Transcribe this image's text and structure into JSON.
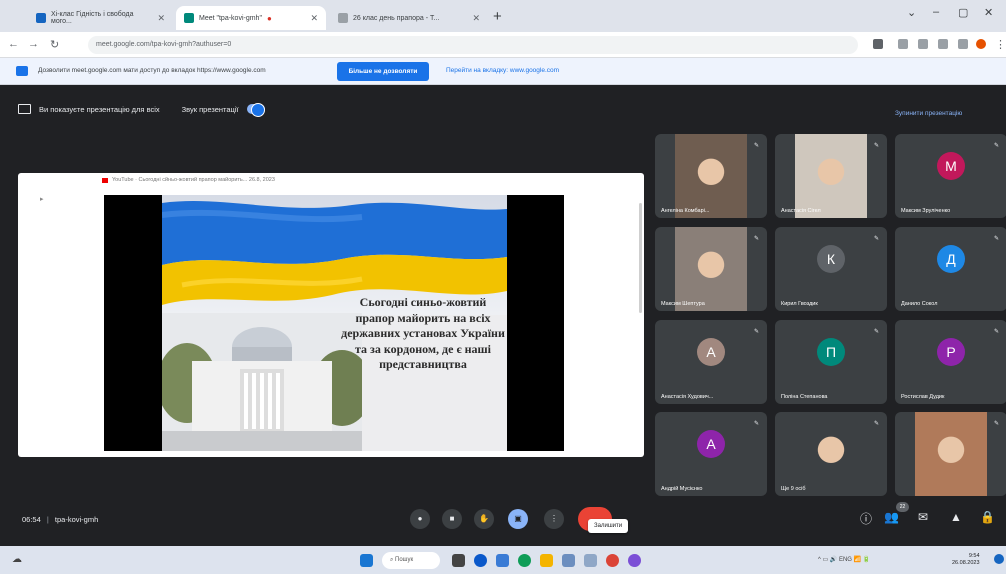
{
  "browser": {
    "tabs": [
      {
        "label": "Хі-клас Гідність і свобода мого..."
      },
      {
        "label": "Meet \"tpa-kovi-gmh\""
      },
      {
        "label": "26 клас день прапора - Т..."
      }
    ],
    "url": "meet.google.com/tpa-kovi-gmh?authuser=0"
  },
  "infobar": {
    "message": "Дозволити meet.google.com мати доступ до вкладок https://www.google.com",
    "button_label": "Більше не дозволяти",
    "link_label": "Перейти на вкладку: www.google.com"
  },
  "meet": {
    "presenting_text": "Ви показуєте презентацію для всіх",
    "sound_label": "Звук презентації",
    "stop_label": "Зупинити презентацію",
    "youtube_caption": "YouTube · Сьогодні сйньо-жовтий прапор майорить... 26.8, 2023",
    "slide_text": "Сьогодні синьо-жовтий прапор майорить на всіх державних установах України та за кордоном, де є наші представництва",
    "time": "06:54",
    "meeting_code": "tpa-kovi-gmh",
    "tooltip": "Залишити",
    "participant_count": "22",
    "participants": [
      {
        "name": "Ангеліна Комбарі...",
        "initial": "",
        "color": "#6f5d50"
      },
      {
        "name": "Анастасія Сігел",
        "initial": "",
        "color": "#cfc7bd"
      },
      {
        "name": "Максим Зруліченко",
        "initial": "М",
        "color": "#c2185b"
      },
      {
        "name": "Максим Шептура",
        "initial": "",
        "color": "#8a7f78"
      },
      {
        "name": "Кирил Гвоздик",
        "initial": "К",
        "color": "#5f6368"
      },
      {
        "name": "Данило Сокол",
        "initial": "Д",
        "color": "#1e88e5"
      },
      {
        "name": "Анастасія Худович...",
        "initial": "А",
        "color": "#a1887f"
      },
      {
        "name": "Поліна Степанова",
        "initial": "П",
        "color": "#00897b"
      },
      {
        "name": "Ростислав Дудик",
        "initial": "Р",
        "color": "#8e24aa"
      },
      {
        "name": "Андрій Мусієнко",
        "initial": "А",
        "color": "#8e24aa"
      },
      {
        "name": "Ще 9 осіб",
        "initial": "",
        "color": "#3c4043"
      },
      {
        "name": "",
        "initial": "",
        "color": "#b07a5a"
      }
    ]
  },
  "taskbar": {
    "search": "Пошук",
    "clock_time": "9:54",
    "clock_date": "26.08.2023"
  }
}
